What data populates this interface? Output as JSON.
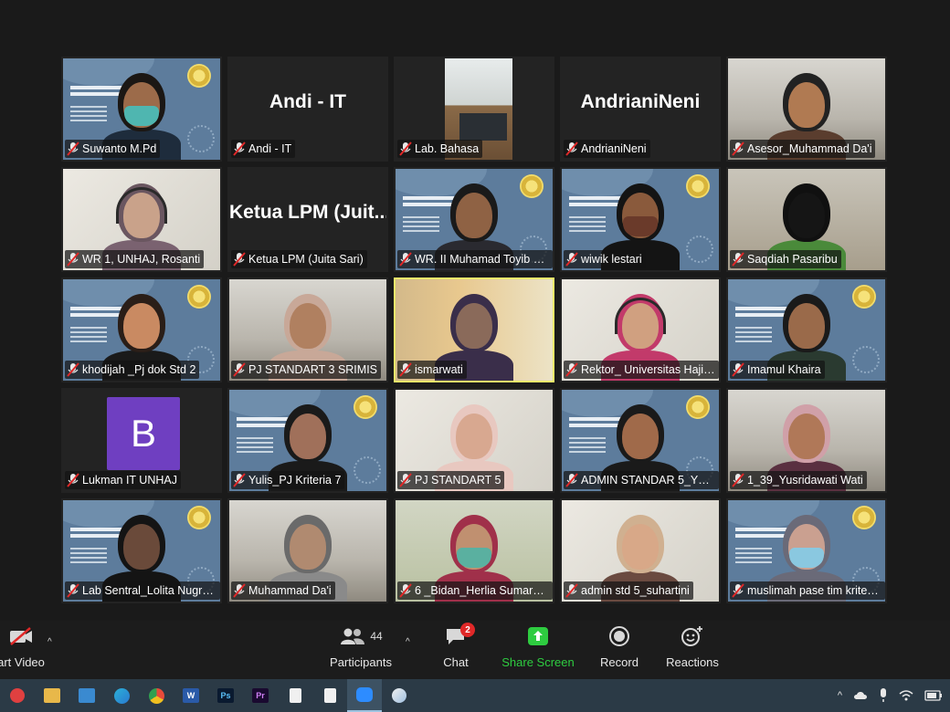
{
  "gallery": {
    "tiles": [
      {
        "name": "Suwanto M.Pd",
        "bg": "banner",
        "kind": "person",
        "skin": "#9c6b4a",
        "hair": "#1b1714",
        "shirt": "#1e2c3c",
        "mask": "#4fb6b0"
      },
      {
        "name": "Andi - IT",
        "bg": "dark",
        "kind": "text",
        "display_text": "Andi - IT"
      },
      {
        "name": "Lab. Bahasa",
        "bg": "lab",
        "kind": "lab"
      },
      {
        "name": "AndrianiNeni",
        "bg": "dark",
        "kind": "text",
        "display_text": "AndrianiNeni"
      },
      {
        "name": "Asesor_Muhammad Da'i",
        "bg": "room",
        "kind": "person",
        "skin": "#b07a52",
        "hair": "#222",
        "shirt": "#5a3d2e"
      },
      {
        "name": "WR 1, UNHAJ, Rosanti",
        "bg": "light",
        "kind": "person",
        "skin": "#c9a28a",
        "hair": "#6a5660",
        "shirt": "#7a6270",
        "headset": true
      },
      {
        "name": "Ketua LPM (Juita Sari)",
        "bg": "dark",
        "kind": "text",
        "display_text": "Ketua LPM (Juit..."
      },
      {
        "name": "WR. II Muhamad Toyib D...",
        "bg": "banner",
        "kind": "person",
        "skin": "#8f6244",
        "hair": "#1a1a1a",
        "shirt": "#2a2a30"
      },
      {
        "name": "wiwik lestari",
        "bg": "banner",
        "kind": "person",
        "skin": "#8a5a3c",
        "hair": "#141414",
        "shirt": "#141414",
        "mask": "#6a3a2a"
      },
      {
        "name": "Saqdiah Pasaribu",
        "bg": "office",
        "kind": "person",
        "skin": "#151515",
        "hair": "#101010",
        "shirt": "#4a8a3a"
      },
      {
        "name": "khodijah _Pj dok Std 2",
        "bg": "banner",
        "kind": "person",
        "skin": "#c98a62",
        "hair": "#2a1e18",
        "shirt": "#1a1a1a"
      },
      {
        "name": "PJ STANDART 3 SRIMIS",
        "bg": "room",
        "kind": "person",
        "skin": "#b08060",
        "hair": "#c8a898",
        "shirt": "#c8a898"
      },
      {
        "name": "ismarwati",
        "bg": "orange",
        "kind": "person",
        "skin": "#8a6a5a",
        "hair": "#3a2e4a",
        "shirt": "#3a2e4a",
        "active": true
      },
      {
        "name": "Rektor_ Universitas Haji sum...",
        "bg": "light",
        "kind": "person",
        "skin": "#d0a080",
        "hair": "#c23a6a",
        "shirt": "#c23a6a",
        "headset": true
      },
      {
        "name": "Imamul Khaira",
        "bg": "banner",
        "kind": "person",
        "skin": "#9a6a4a",
        "hair": "#1a1a1a",
        "shirt": "#2a3a30"
      },
      {
        "name": "Lukman IT UNHAJ",
        "bg": "dark",
        "kind": "avatar",
        "avatar_letter": "B"
      },
      {
        "name": "Yulis_PJ Kriteria 7",
        "bg": "banner",
        "kind": "person",
        "skin": "#a0705a",
        "hair": "#1a1a1a",
        "shirt": "#1a1a1a"
      },
      {
        "name": "PJ STANDART 5",
        "bg": "light",
        "kind": "person",
        "skin": "#d8a890",
        "hair": "#e8c8c0",
        "shirt": "#e8c8c0"
      },
      {
        "name": "ADMIN STANDAR 5_YETTI",
        "bg": "banner",
        "kind": "person",
        "skin": "#a06a4a",
        "hair": "#1a1a1a",
        "shirt": "#1a1a1a"
      },
      {
        "name": "1_39_Yusridawati Wati",
        "bg": "room",
        "kind": "person",
        "skin": "#b07858",
        "hair": "#d0a0a8",
        "shirt": "#5a3040"
      },
      {
        "name": "Lab Sentral_Lolita Nugra...",
        "bg": "banner",
        "kind": "person",
        "skin": "#6a4a3a",
        "hair": "#141414",
        "shirt": "#141414"
      },
      {
        "name": "Muhammad Da'i",
        "bg": "room",
        "kind": "person",
        "skin": "#b08a70",
        "hair": "#6a6a6a",
        "shirt": "#8a8a8a"
      },
      {
        "name": "6 _Bidan_Herlia Sumardh...",
        "bg": "green",
        "kind": "person",
        "skin": "#c09070",
        "hair": "#a0304a",
        "shirt": "#a0304a",
        "mask": "#5ab0a0"
      },
      {
        "name": "admin std 5_suhartini",
        "bg": "light",
        "kind": "person",
        "skin": "#d8a888",
        "hair": "#d0b090",
        "shirt": "#6a4a40"
      },
      {
        "name": "muslimah pase tim kriteri...",
        "bg": "banner",
        "kind": "person",
        "skin": "#caa090",
        "hair": "#6a6a78",
        "shirt": "#6a6a78",
        "mask": "#8ac8e0"
      }
    ]
  },
  "toolbar": {
    "start_video_label": "art Video",
    "participants_label": "Participants",
    "participants_count": "44",
    "chat_label": "Chat",
    "chat_badge": "2",
    "share_label": "Share Screen",
    "record_label": "Record",
    "reactions_label": "Reactions"
  },
  "taskbar": {
    "apps": [
      "zoom-red",
      "file-explorer",
      "mail",
      "edge",
      "chrome",
      "word",
      "photoshop",
      "premiere",
      "notepad",
      "notepad",
      "zoom",
      "paint"
    ]
  },
  "colors": {
    "share_green": "#2ecc40",
    "badge_red": "#e02828",
    "active_border": "#e8e86a",
    "muted_red": "#e02828",
    "avatar_purple": "#6f3fc1"
  }
}
